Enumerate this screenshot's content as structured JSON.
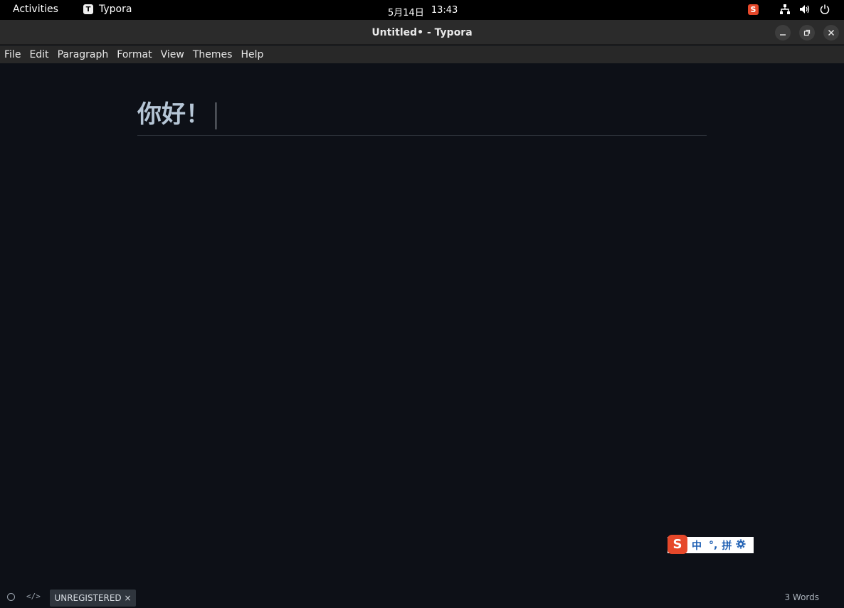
{
  "topbar": {
    "activities": "Activities",
    "app_name": "Typora",
    "app_icon_letter": "T",
    "date": "5月14日",
    "time": "13:43",
    "tray_icons": [
      "sogou-ime-icon",
      "network-icon",
      "volume-icon",
      "power-icon"
    ]
  },
  "window": {
    "title": "Untitled• - Typora",
    "buttons": [
      "minimize",
      "maximize",
      "close"
    ]
  },
  "menu": {
    "items": [
      "File",
      "Edit",
      "Paragraph",
      "Format",
      "View",
      "Themes",
      "Help"
    ]
  },
  "editor": {
    "heading": "你好！"
  },
  "ime": {
    "logo": "S",
    "mode": "中",
    "punct": "°,",
    "input": "拼",
    "settings_icon": "gear-icon"
  },
  "status": {
    "unregistered": "UNREGISTERED ×",
    "word_count": "3 Words",
    "code_toggle": "</>"
  },
  "colors": {
    "editor_bg": "#0d1017",
    "heading_text": "#b6c6d6",
    "sogou_brand": "#e6482a"
  }
}
